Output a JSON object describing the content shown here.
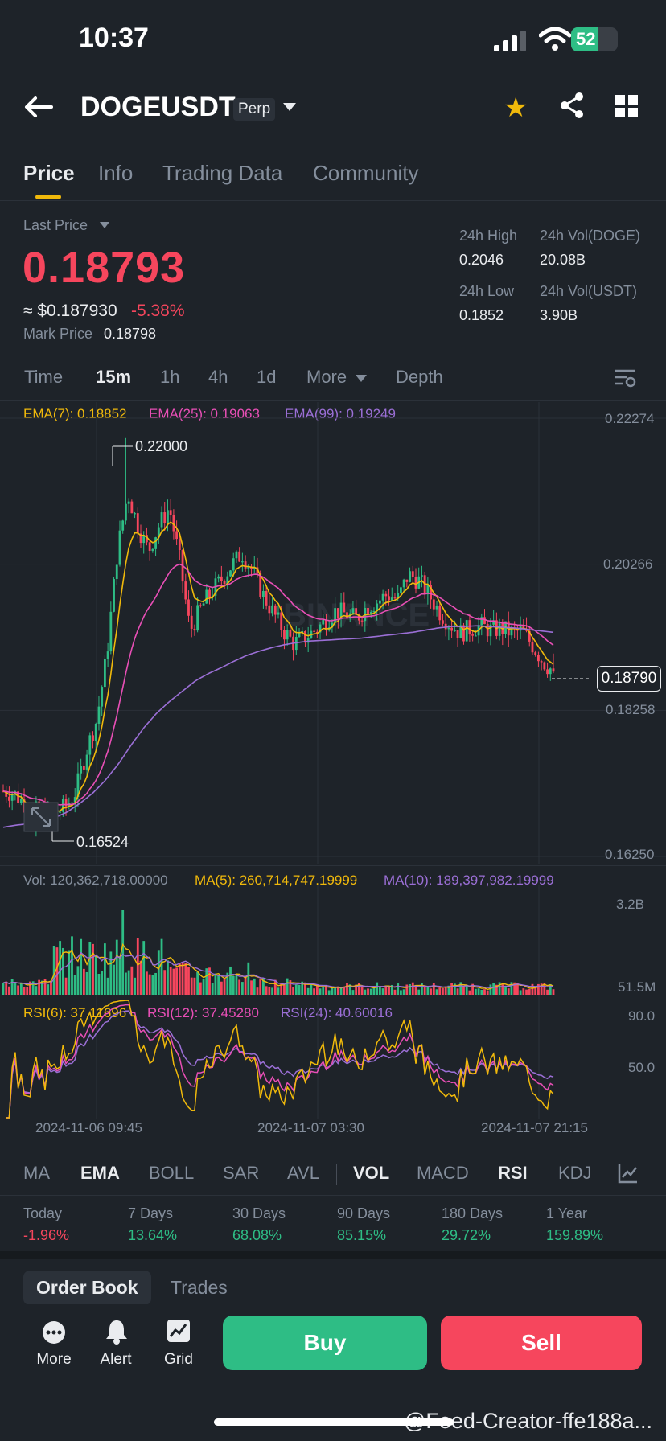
{
  "status": {
    "time": "10:37",
    "battery": "52"
  },
  "header": {
    "symbol": "DOGEUSDT",
    "badge": "Perp"
  },
  "tabs": [
    "Price",
    "Info",
    "Trading Data",
    "Community"
  ],
  "ticker": {
    "last_price_label": "Last Price",
    "last_price": "0.18793",
    "usd_value": "≈ $0.187930",
    "change": "-5.38%",
    "mark_label": "Mark Price",
    "mark_value": "0.18798",
    "high_label": "24h High",
    "high": "0.2046",
    "low_label": "24h Low",
    "low": "0.1852",
    "vol_base_label": "24h Vol(DOGE)",
    "vol_base": "20.08B",
    "vol_quote_label": "24h Vol(USDT)",
    "vol_quote": "3.90B"
  },
  "timeframes": [
    "Time",
    "15m",
    "1h",
    "4h",
    "1d",
    "More",
    "Depth"
  ],
  "ema_legend": {
    "ema7": "EMA(7): 0.18852",
    "ema25": "EMA(25): 0.19063",
    "ema99": "EMA(99): 0.19249"
  },
  "price_axis": [
    "0.22274",
    "0.20266",
    "0.18258",
    "0.16250"
  ],
  "current_price_tag": "0.18790",
  "annotations": {
    "high": "0.22000",
    "low": "0.16524"
  },
  "vol_legend": {
    "vol": "Vol: 120,362,718.00000",
    "ma5": "MA(5): 260,714,747.19999",
    "ma10": "MA(10): 189,397,982.19999"
  },
  "vol_axis": [
    "3.2B",
    "51.5M"
  ],
  "rsi_legend": {
    "rsi6": "RSI(6): 37.11696",
    "rsi12": "RSI(12): 37.45280",
    "rsi24": "RSI(24): 40.60016"
  },
  "rsi_axis": [
    "90.0",
    "50.0"
  ],
  "time_axis": [
    "2024-11-06 09:45",
    "2024-11-07 03:30",
    "2024-11-07 21:15"
  ],
  "indicators": [
    "MA",
    "EMA",
    "BOLL",
    "SAR",
    "AVL",
    "VOL",
    "MACD",
    "RSI",
    "KDJ"
  ],
  "performance": [
    {
      "label": "Today",
      "value": "-1.96%"
    },
    {
      "label": "7 Days",
      "value": "13.64%"
    },
    {
      "label": "30 Days",
      "value": "68.08%"
    },
    {
      "label": "90 Days",
      "value": "85.15%"
    },
    {
      "label": "180 Days",
      "value": "29.72%"
    },
    {
      "label": "1 Year",
      "value": "159.89%"
    }
  ],
  "order_tabs": [
    "Order Book",
    "Trades"
  ],
  "bottom": {
    "more": "More",
    "alert": "Alert",
    "grid": "Grid",
    "buy": "Buy",
    "sell": "Sell"
  },
  "watermark": "@Feed-Creator-ffe188a...",
  "colors": {
    "up": "#2ebd85",
    "down": "#f6465d",
    "accent": "#f0b90b",
    "ema7": "#f0b90b",
    "ema25": "#e84fb6",
    "ema99": "#9b6fd6"
  },
  "chart_data": {
    "type": "candlestick",
    "title": "",
    "price_range": [
      0.1625,
      0.22274
    ],
    "high": 0.22,
    "low": 0.16524,
    "last": 0.1879,
    "close_path": [
      0.1715,
      0.1712,
      0.1698,
      0.1688,
      0.1682,
      0.1685,
      0.1693,
      0.1715,
      0.177,
      0.1812,
      0.1905,
      0.2045,
      0.2125,
      0.2078,
      0.2045,
      0.208,
      0.2105,
      0.2032,
      0.1935,
      0.1965,
      0.1988,
      0.2005,
      0.2025,
      0.2042,
      0.2018,
      0.1985,
      0.196,
      0.1935,
      0.1918,
      0.1925,
      0.1935,
      0.1948,
      0.1962,
      0.1958,
      0.1952,
      0.1968,
      0.1975,
      0.1985,
      0.1978,
      0.2012,
      0.2005,
      0.1985,
      0.1962,
      0.1945,
      0.1932,
      0.1938,
      0.1942,
      0.1936,
      0.1938,
      0.1932,
      0.1935,
      0.1915,
      0.1893,
      0.1879
    ],
    "ema99_path": [
      0.1665,
      0.1668,
      0.167,
      0.1672,
      0.1678,
      0.1686,
      0.1698,
      0.1712,
      0.173,
      0.1752,
      0.1778,
      0.1802,
      0.1822,
      0.1838,
      0.1852,
      0.1866,
      0.1876,
      0.1884,
      0.1893,
      0.1901,
      0.1907,
      0.1912,
      0.1916,
      0.1919,
      0.1921,
      0.1922,
      0.1923,
      0.1924,
      0.1925,
      0.1927,
      0.1929,
      0.1931,
      0.1933,
      0.1936,
      0.1939,
      0.1941,
      0.1941,
      0.1942,
      0.1941,
      0.194,
      0.1939,
      0.1937,
      0.1935,
      0.1933
    ]
  }
}
